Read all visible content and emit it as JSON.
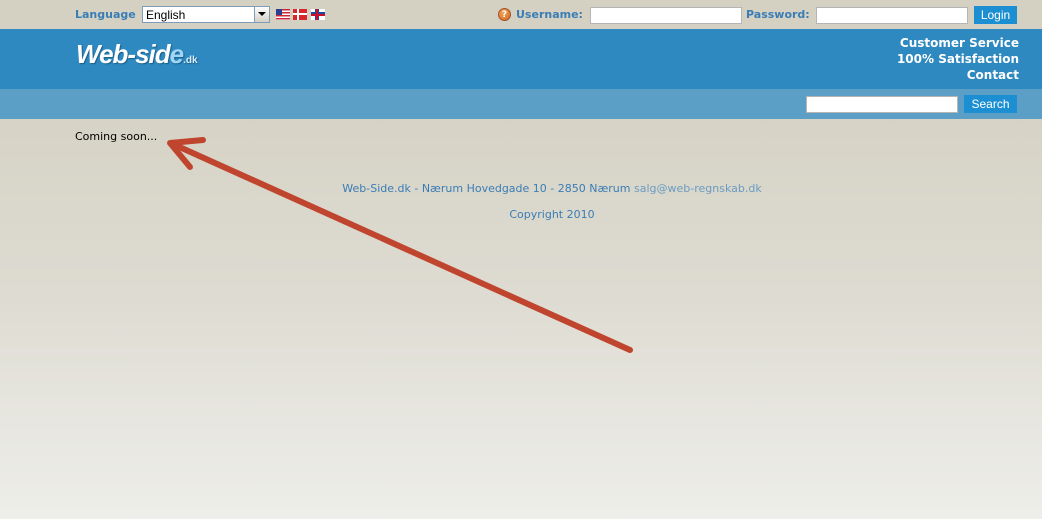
{
  "topbar": {
    "language_label": "Language",
    "language_value": "English",
    "flags": [
      "us-flag-icon",
      "dk-flag-icon",
      "fo-flag-icon"
    ],
    "username_label": "Username:",
    "password_label": "Password:",
    "username_value": "",
    "password_value": "",
    "login_label": "Login"
  },
  "header": {
    "logo_parts": {
      "a": "Web",
      "b": "-sid",
      "c": "e",
      "d": ".dk"
    },
    "links": [
      "Customer Service",
      "100% Satisfaction",
      "Contact"
    ]
  },
  "search": {
    "value": "",
    "button_label": "Search"
  },
  "main": {
    "message": "Coming soon..."
  },
  "footer": {
    "address": "Web-Side.dk - Nærum Hovedgade 10 - 2850 Nærum",
    "email": "salg@web-regnskab.dk",
    "copyright": "Copyright 2010"
  },
  "colors": {
    "accent_blue": "#2e89c0",
    "button_blue": "#1c8fd2",
    "label_blue": "#3a7db5",
    "arrow": "#c0452f"
  }
}
